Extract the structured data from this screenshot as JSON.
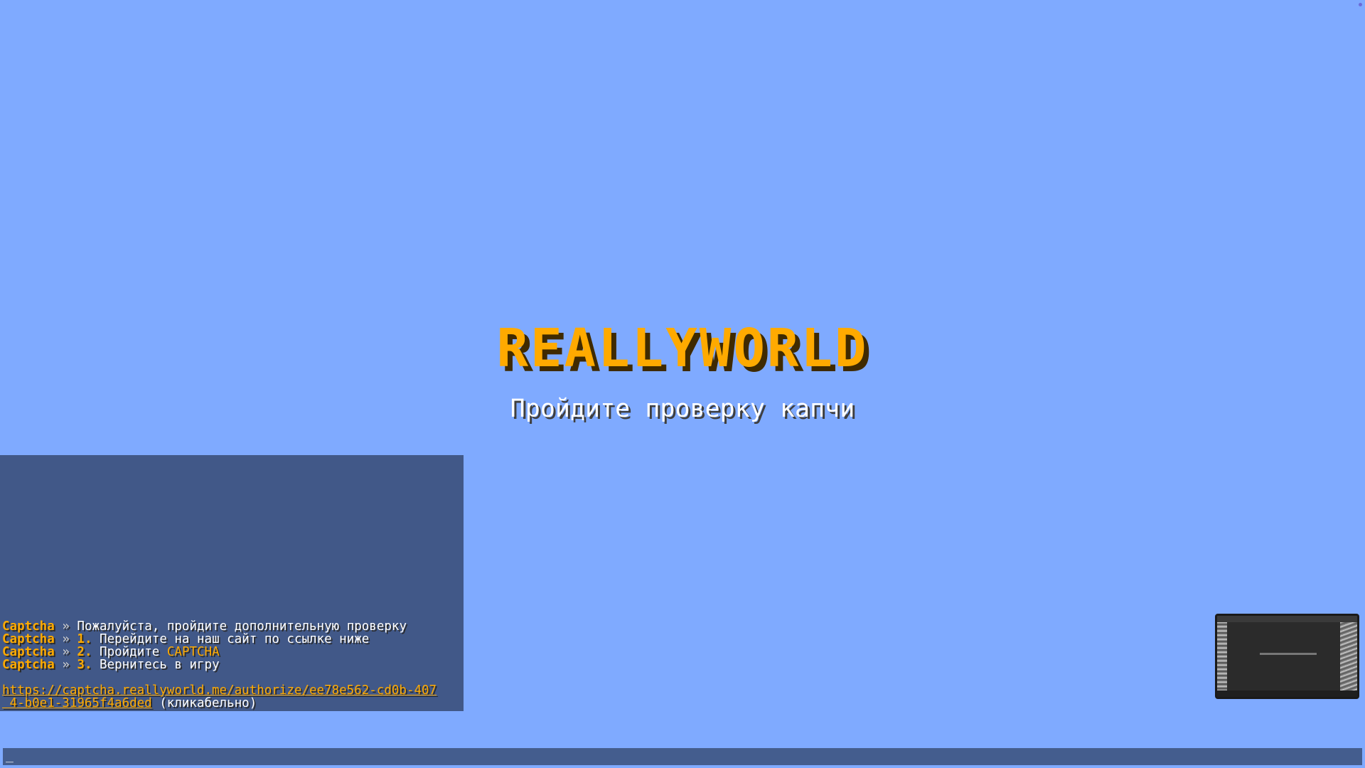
{
  "screen": {
    "title": "REALLYWORLD",
    "subtitle": "Пройдите проверку капчи"
  },
  "chat": {
    "prefix": "Captcha",
    "arrow": "»",
    "lines": [
      {
        "num": "",
        "text": "Пожалуйста, пройдите дополнительную проверку",
        "highlight": ""
      },
      {
        "num": "1.",
        "text": "Перейдите на наш сайт по ссылке ниже",
        "highlight": ""
      },
      {
        "num": "2.",
        "text": "Пройдите",
        "highlight": "CAPTCHA"
      },
      {
        "num": "3.",
        "text": "Вернитесь в игру",
        "highlight": ""
      }
    ],
    "link_line1": "https://captcha.reallyworld.me/authorize/ee78e562-cd0b-407",
    "link_line2": " 4-b0e1-31965f4a6ded",
    "link_suffix": "(кликабельно)"
  },
  "input": {
    "value": "_"
  },
  "colors": {
    "background": "#7faaff",
    "accent": "#ffaa00"
  }
}
